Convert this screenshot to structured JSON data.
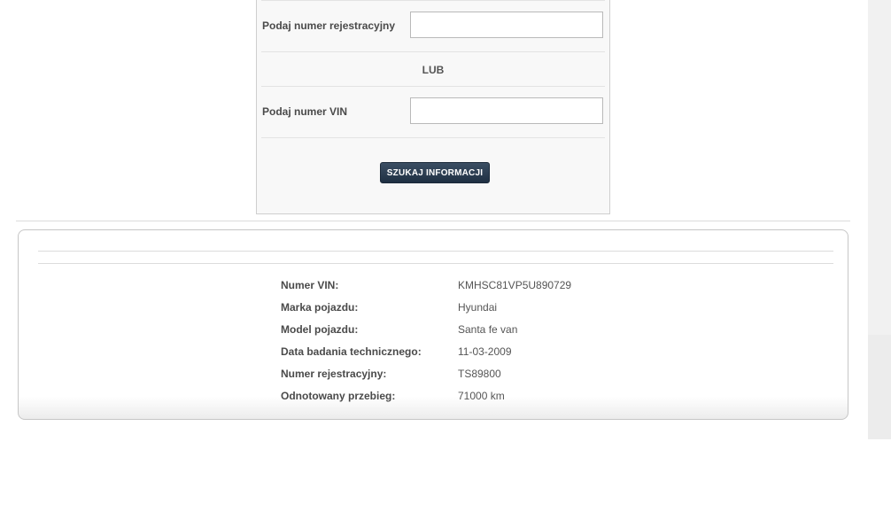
{
  "search_form": {
    "plate_label": "Podaj numer rejestracyjny",
    "plate_value": "",
    "or_text": "LUB",
    "vin_label": "Podaj numer VIN",
    "vin_value": "",
    "submit_label": "SZUKAJ INFORMACJI"
  },
  "results": {
    "rows": [
      {
        "label": "Numer VIN:",
        "value": "KMHSC81VP5U890729"
      },
      {
        "label": "Marka pojazdu:",
        "value": "Hyundai"
      },
      {
        "label": "Model pojazdu:",
        "value": "Santa fe van"
      },
      {
        "label": "Data badania technicznego:",
        "value": "11-03-2009"
      },
      {
        "label": "Numer rejestracyjny:",
        "value": "TS89800"
      },
      {
        "label": "Odnotowany przebieg:",
        "value": "71000 km"
      }
    ]
  },
  "colors": {
    "button_bg": "#2b3d52",
    "panel_bg": "#f8f8f8",
    "label_text": "#4a4a4a"
  }
}
